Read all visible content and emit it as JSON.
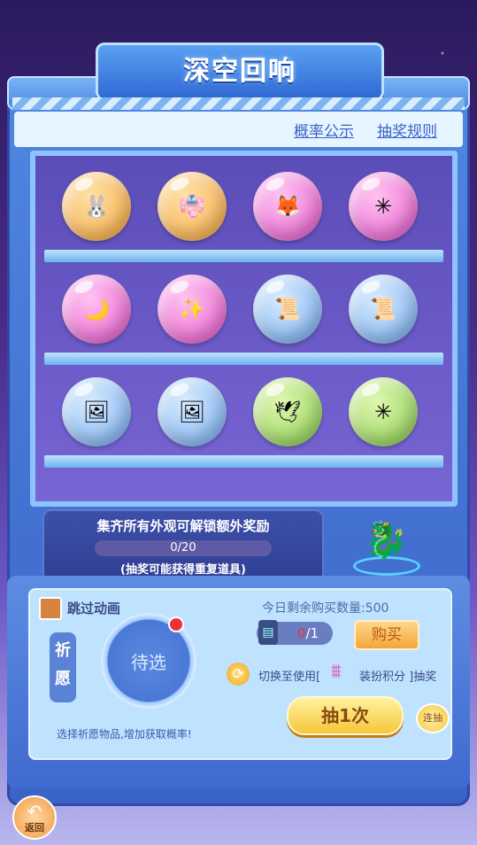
{
  "title": "深空回响",
  "links": {
    "probability": "概率公示",
    "rules": "抽奖规则"
  },
  "shelves": [
    [
      {
        "color": "orange",
        "icon": "🐰"
      },
      {
        "color": "orange",
        "icon": "👘"
      },
      {
        "color": "pink",
        "icon": "🦊"
      },
      {
        "color": "pink",
        "icon": "✳"
      }
    ],
    [
      {
        "color": "pink",
        "icon": "🌙"
      },
      {
        "color": "pink",
        "icon": "✨"
      },
      {
        "color": "blue",
        "icon": "📜"
      },
      {
        "color": "blue",
        "icon": "📜"
      }
    ],
    [
      {
        "color": "blue",
        "icon": "🖼"
      },
      {
        "color": "blue",
        "icon": "🖼"
      },
      {
        "color": "green",
        "icon": "🕊"
      },
      {
        "color": "green",
        "icon": "✳"
      }
    ]
  ],
  "collect": {
    "title": "集齐所有外观可解锁额外奖励",
    "progress": "0/20",
    "note": "(抽奖可能获得重复道具)"
  },
  "controls": {
    "skip_label": "跳过动画",
    "wish_tag": "祈愿",
    "wish_pending": "待选",
    "hint": "选择祈愿物品,增加获取概率!",
    "remaining": "今日剩余购买数量:500",
    "ticket_owned": "0",
    "ticket_need": "/1",
    "buy": "购买",
    "switch_prefix": "切换至使用[",
    "switch_suffix": "装扮积分 ]抽奖",
    "draw_once": "抽1次",
    "draw_multi": "连抽"
  },
  "back_label": "返回"
}
